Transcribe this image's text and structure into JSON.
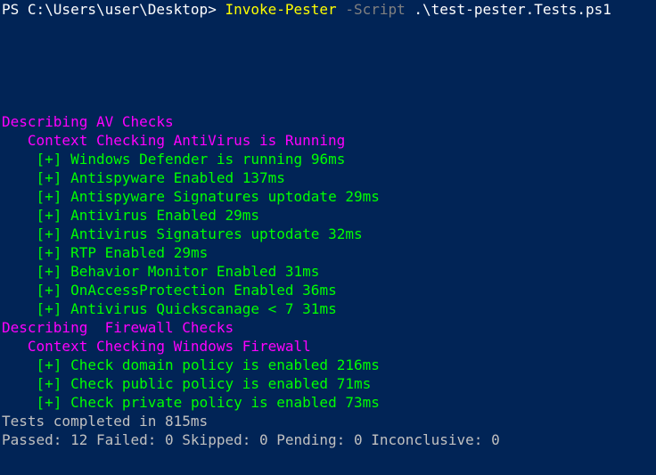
{
  "prompt": {
    "ps": "PS C:\\Users\\user\\Desktop> ",
    "cmd": "Invoke-Pester",
    "param": " -Script",
    "arg": " .\\test-pester.Tests.ps1"
  },
  "blocks": [
    {
      "describe": "Describing AV Checks",
      "context": "Context Checking AntiVirus is Running",
      "tests": [
        {
          "name": "Windows Defender is running",
          "ms": "96ms"
        },
        {
          "name": "Antispyware Enabled",
          "ms": "137ms"
        },
        {
          "name": "Antispyware Signatures uptodate",
          "ms": "29ms"
        },
        {
          "name": "Antivirus Enabled",
          "ms": "29ms"
        },
        {
          "name": "Antivirus Signatures uptodate",
          "ms": "32ms"
        },
        {
          "name": "RTP Enabled",
          "ms": "29ms"
        },
        {
          "name": "Behavior Monitor Enabled",
          "ms": "31ms"
        },
        {
          "name": "OnAccessProtection Enabled",
          "ms": "36ms"
        },
        {
          "name": "Antivirus Quickscanage < 7",
          "ms": "31ms"
        }
      ]
    },
    {
      "describe": "Describing  Firewall Checks",
      "context": "Context Checking Windows Firewall",
      "tests": [
        {
          "name": "Check domain policy is enabled",
          "ms": "216ms"
        },
        {
          "name": "Check public policy is enabled",
          "ms": "71ms"
        },
        {
          "name": "Check private policy is enabled",
          "ms": "73ms"
        }
      ]
    }
  ],
  "summary": {
    "completed": "Tests completed in 815ms",
    "counts": "Passed: 12 Failed: 0 Skipped: 0 Pending: 0 Inconclusive: 0"
  },
  "pass_marker": "[+]"
}
